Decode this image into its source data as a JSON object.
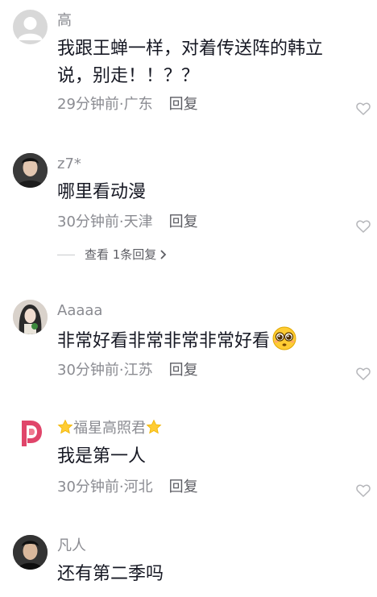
{
  "comments": [
    {
      "username": "高",
      "text": "我跟王蝉一样，对着传送阵的韩立说，别走！！？？",
      "time_location": "29分钟前·广东",
      "reply_label": "回复"
    },
    {
      "username": "z7*",
      "text": "哪里看动漫",
      "time_location": "30分钟前·天津",
      "reply_label": "回复",
      "view_replies_label": "查看 1条回复"
    },
    {
      "username": "Aaaaa",
      "text": "非常好看非常非常非常好看",
      "time_location": "30分钟前·江苏",
      "reply_label": "回复"
    },
    {
      "username": "福星高照君",
      "text": "我是第一人",
      "time_location": "30分钟前·河北",
      "reply_label": "回复"
    },
    {
      "username": "凡人",
      "text": "还有第二季吗",
      "time_location": "",
      "reply_label": ""
    }
  ],
  "icons": {
    "like": "heart-outline-icon",
    "star": "star-icon",
    "emoji": "pleading-face-icon",
    "chevron": "chevron-right-icon"
  },
  "colors": {
    "text_primary": "#161823",
    "text_secondary": "#8a8b91",
    "star": "#ffcc33",
    "avatar_placeholder": "#d8d8d8"
  }
}
